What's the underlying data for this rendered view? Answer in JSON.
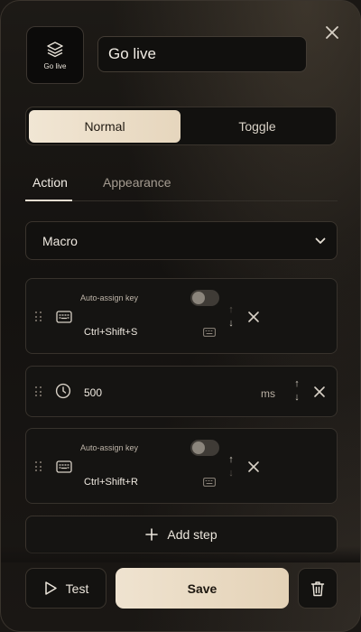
{
  "header": {
    "icon_label": "Go live",
    "name_value": "Go live",
    "close_icon": "close-icon",
    "tile_icon": "stack-icon"
  },
  "mode": {
    "options": [
      "Normal",
      "Toggle"
    ],
    "selected": "Normal"
  },
  "tabs": {
    "items": [
      "Action",
      "Appearance"
    ],
    "active": "Action"
  },
  "action_type": {
    "value": "Macro",
    "icon": "chevron-down-icon"
  },
  "steps": [
    {
      "type": "key",
      "auto_assign_label": "Auto-assign key",
      "auto_assign_on": false,
      "keys": "Ctrl+Shift+S",
      "move_up_enabled": false,
      "move_down_enabled": true
    },
    {
      "type": "delay",
      "value": "500",
      "unit": "ms",
      "move_up_enabled": true,
      "move_down_enabled": true
    },
    {
      "type": "key",
      "auto_assign_label": "Auto-assign key",
      "auto_assign_on": false,
      "keys": "Ctrl+Shift+R",
      "move_up_enabled": true,
      "move_down_enabled": false
    }
  ],
  "add_step_label": "Add step",
  "footer": {
    "test_label": "Test",
    "save_label": "Save"
  },
  "colors": {
    "accent": "#ecdfcb",
    "background": "#141210"
  }
}
